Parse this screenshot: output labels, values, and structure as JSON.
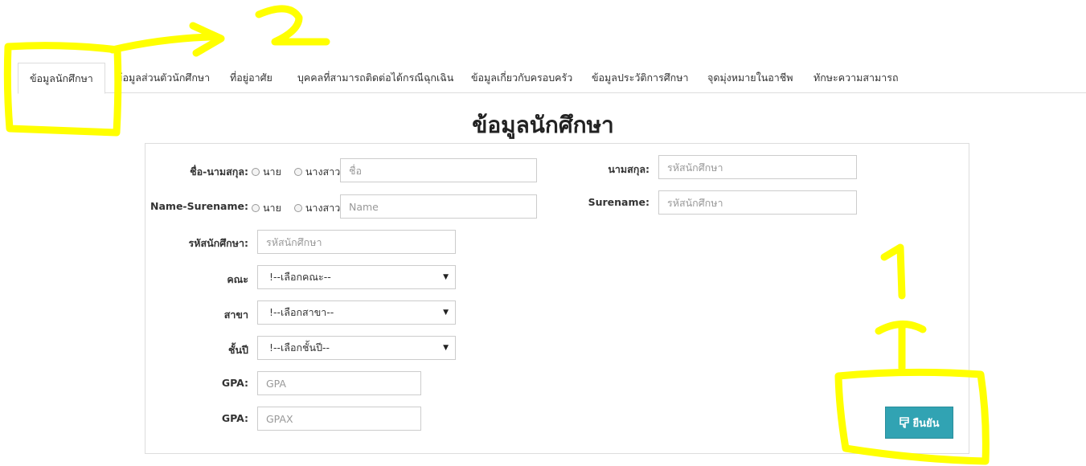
{
  "tabs": [
    {
      "label": "ข้อมูลนักศึกษา",
      "active": true
    },
    {
      "label": "ข้อมูลส่วนตัวนักศึกษา",
      "active": false
    },
    {
      "label": "ที่อยู่อาศัย",
      "active": false
    },
    {
      "label": "บุคคลที่สามารถติดต่อได้กรณีฉุกเฉิน",
      "active": false
    },
    {
      "label": "ข้อมูลเกี่ยวกับครอบครัว",
      "active": false
    },
    {
      "label": "ข้อมูลประวัติการศึกษา",
      "active": false
    },
    {
      "label": "จุดมุ่งหมายในอาชีพ",
      "active": false
    },
    {
      "label": "ทักษะความสามารถ",
      "active": false
    }
  ],
  "page_title": "ข้อมูลนักศึกษา",
  "form": {
    "thai_name": {
      "label": "ชื่อ-นามสกุล:",
      "radio_mr": "นาย",
      "radio_ms": "นางสาว",
      "placeholder": "ชื่อ"
    },
    "eng_name": {
      "label": "Name-Surename:",
      "radio_mr": "นาย",
      "radio_ms": "นางสาว",
      "placeholder": "Name"
    },
    "thai_surname": {
      "label": "นามสกุล:",
      "placeholder": "รหัสนักศึกษา"
    },
    "eng_surname": {
      "label": "Surename:",
      "placeholder": "รหัสนักศึกษา"
    },
    "student_id": {
      "label": "รหัสนักศึกษา:",
      "placeholder": "รหัสนักศึกษา"
    },
    "faculty": {
      "label": "คณะ",
      "selected": "!--เลือกคณะ--"
    },
    "major": {
      "label": "สาขา",
      "selected": "!--เลือกสาขา--"
    },
    "year": {
      "label": "ชั้นปี",
      "selected": "!--เลือกชั้นปี--"
    },
    "gpa": {
      "label": "GPA:",
      "placeholder": "GPA"
    },
    "gpax": {
      "label": "GPA:",
      "placeholder": "GPAX"
    },
    "confirm_label": "ยืนยัน"
  },
  "annotations": {
    "number_one": "1",
    "number_two": "2",
    "color": "#ffff00"
  },
  "icons": {
    "confirm": "thumbs-down-icon",
    "select_caret": "caret-down-icon"
  },
  "colors": {
    "button_bg": "#31a3b3",
    "tab_border": "#dddddd"
  }
}
